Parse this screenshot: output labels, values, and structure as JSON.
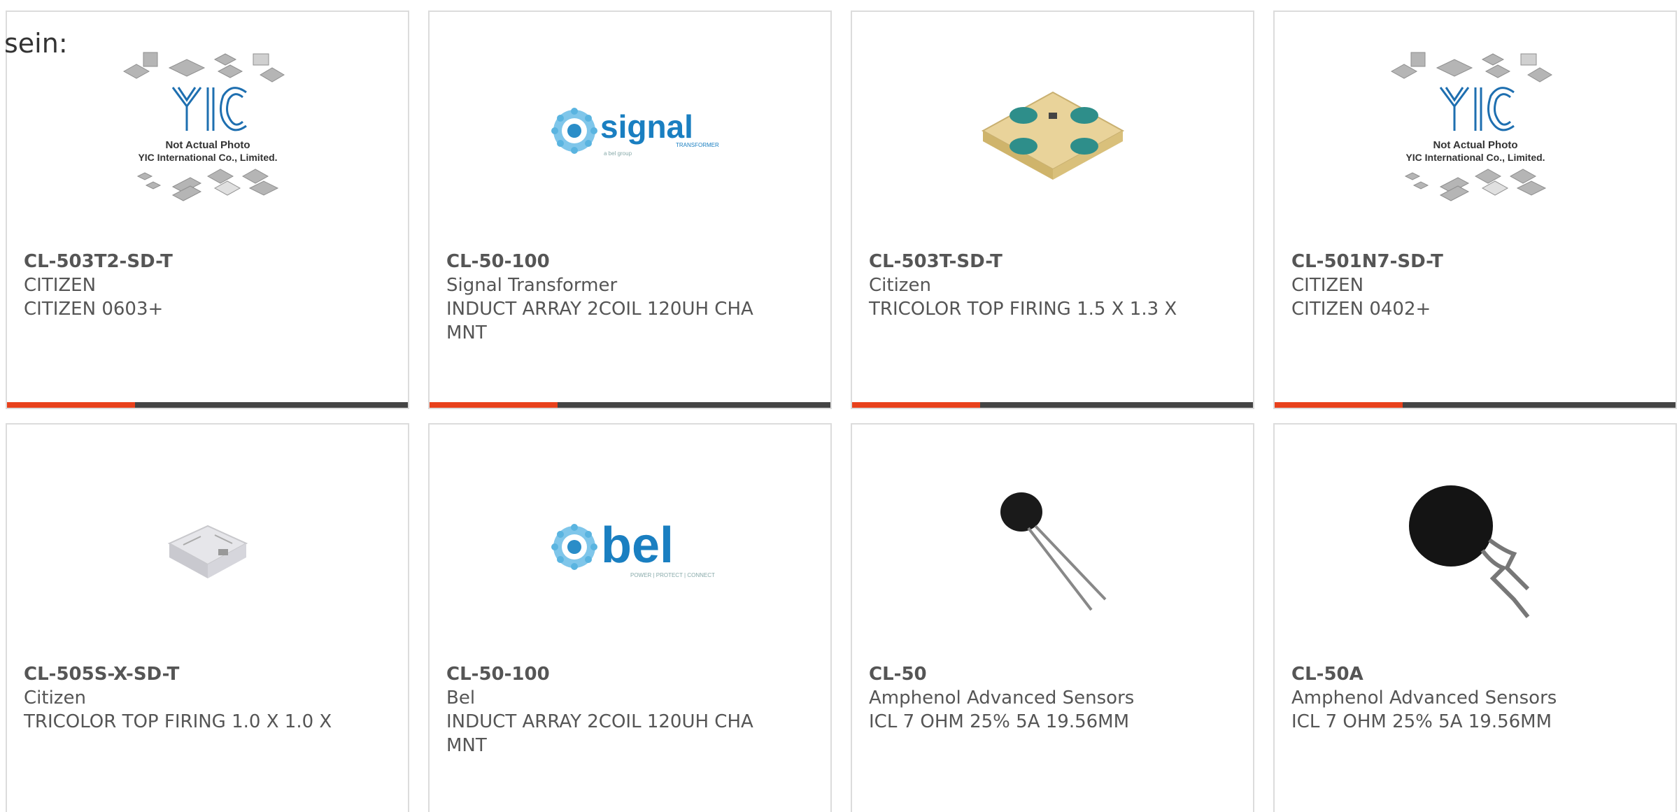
{
  "heading_fragment": "sein:",
  "colors": {
    "accent_bar": "#e8411c",
    "dark_bar": "#444444",
    "card_border": "#dcdcdc",
    "text": "#555555"
  },
  "products": [
    {
      "part_no": "CL-503T2-SD-T",
      "manufacturer": "CITIZEN",
      "description": "CITIZEN 0603+",
      "image": "yic-placeholder-image",
      "placeholder_caption_1": "Not Actual Photo",
      "placeholder_caption_2": "YIC International Co., Limited.",
      "placeholder_logo": "YIC"
    },
    {
      "part_no": "CL-50-100",
      "manufacturer": "Signal Transformer",
      "description": "INDUCT ARRAY 2COIL 120UH CHA MNT",
      "image": "signal-transformer-logo",
      "logo_text": "signal",
      "logo_sub": "TRANSFORMER",
      "logo_tag": "a bel group"
    },
    {
      "part_no": "CL-503T-SD-T",
      "manufacturer": "Citizen",
      "description": "TRICOLOR TOP FIRING 1.5 X 1.3 X",
      "image": "tricolor-led-photo"
    },
    {
      "part_no": "CL-501N7-SD-T",
      "manufacturer": "CITIZEN",
      "description": "CITIZEN 0402+",
      "image": "yic-placeholder-image",
      "placeholder_caption_1": "Not Actual Photo",
      "placeholder_caption_2": "YIC International Co., Limited.",
      "placeholder_logo": "YIC"
    },
    {
      "part_no": "CL-505S-X-SD-T",
      "manufacturer": "Citizen",
      "description": "TRICOLOR TOP FIRING 1.0 X 1.0 X",
      "image": "white-led-photo"
    },
    {
      "part_no": "CL-50-100",
      "manufacturer": "Bel",
      "description": "INDUCT ARRAY 2COIL 120UH CHA MNT",
      "image": "bel-logo",
      "logo_text": "bel",
      "logo_tag": "POWER | PROTECT | CONNECT"
    },
    {
      "part_no": "CL-50",
      "manufacturer": "Amphenol Advanced Sensors",
      "description": "ICL 7 OHM 25% 5A 19.56MM",
      "image": "thermistor-photo"
    },
    {
      "part_no": "CL-50A",
      "manufacturer": "Amphenol Advanced Sensors",
      "description": "ICL 7 OHM 25% 5A 19.56MM",
      "image": "thermistor-large-photo"
    }
  ]
}
